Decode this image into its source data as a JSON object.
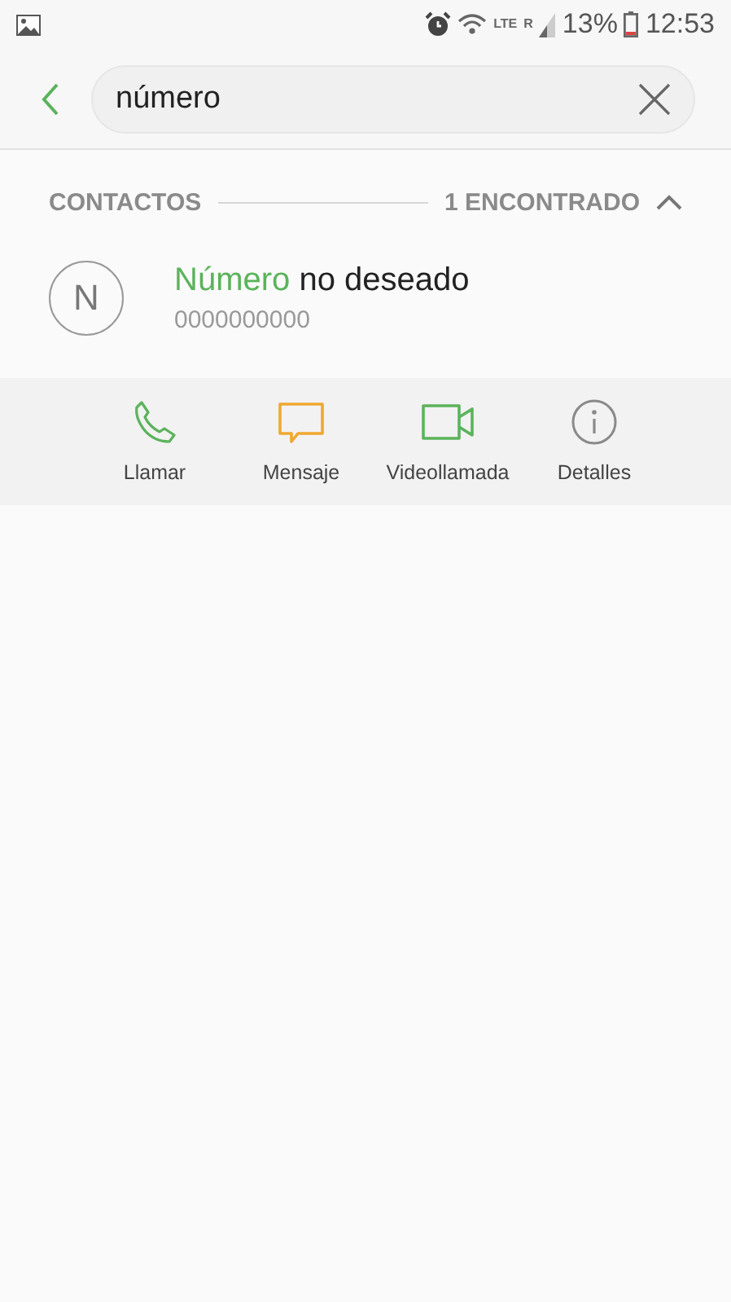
{
  "status_bar": {
    "network": "LTE",
    "roaming": "R",
    "battery": "13%",
    "time": "12:53"
  },
  "search": {
    "value": "número"
  },
  "section": {
    "title": "CONTACTOS",
    "count": "1 ENCONTRADO",
    "expanded": true
  },
  "contact": {
    "initial": "N",
    "name_match": "Número",
    "name_rest": "no deseado",
    "number": "0000000000"
  },
  "actions": [
    {
      "kind": "call",
      "label": "Llamar",
      "color": "#5bb35b"
    },
    {
      "kind": "message",
      "label": "Mensaje",
      "color": "#f0a830"
    },
    {
      "kind": "video",
      "label": "Videollamada",
      "color": "#5bb35b"
    },
    {
      "kind": "details",
      "label": "Detalles",
      "color": "#8a8a8a"
    }
  ]
}
